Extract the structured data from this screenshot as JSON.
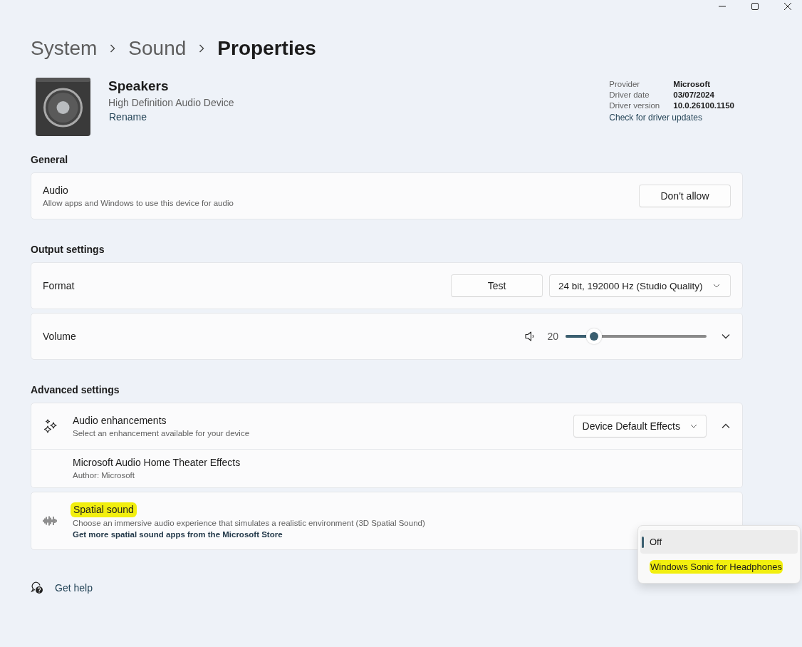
{
  "breadcrumb": [
    "System",
    "Sound",
    "Properties"
  ],
  "device": {
    "name": "Speakers",
    "description": "High Definition Audio Device",
    "rename_link": "Rename"
  },
  "driver_info": {
    "rows": [
      {
        "label": "Provider",
        "value": "Microsoft"
      },
      {
        "label": "Driver date",
        "value": "03/07/2024"
      },
      {
        "label": "Driver version",
        "value": "10.0.26100.1150"
      }
    ],
    "update_link": "Check for driver updates"
  },
  "sections": [
    {
      "heading": "General",
      "cards": [
        {
          "kind": "button",
          "title": "Audio",
          "subtitle": "Allow apps and Windows to use this device for audio",
          "button": "Don't allow"
        }
      ]
    },
    {
      "heading": "Output settings",
      "cards": [
        {
          "kind": "format",
          "title": "Format",
          "button": "Test",
          "dropdown": "24 bit, 192000 Hz (Studio Quality)"
        },
        {
          "kind": "volume",
          "title": "Volume",
          "reading": "20",
          "level": 0.2,
          "expanded": false
        }
      ]
    },
    {
      "heading": "Advanced settings",
      "cards": [
        {
          "kind": "expander",
          "title": "Audio enhancements",
          "subtitle": "Select an enhancement available for your device",
          "dropdown": "Device Default Effects",
          "expanded": true,
          "children": [
            {
              "title": "Microsoft Audio Home Theater Effects",
              "subtitle": "Author: Microsoft"
            }
          ]
        },
        {
          "kind": "spatial",
          "title": "Spatial sound",
          "highlighted": true,
          "subtitle": "Choose an immersive audio experience that simulates a realistic environment (3D Spatial Sound)",
          "link": "Get more spatial sound apps from the Microsoft Store"
        }
      ]
    }
  ],
  "spatial_menu": {
    "options": [
      {
        "label": "Off",
        "selected": true,
        "highlighted": false
      },
      {
        "label": "Windows Sonic for Headphones",
        "selected": false,
        "highlighted": true
      }
    ]
  },
  "help": {
    "label": "Get help"
  }
}
